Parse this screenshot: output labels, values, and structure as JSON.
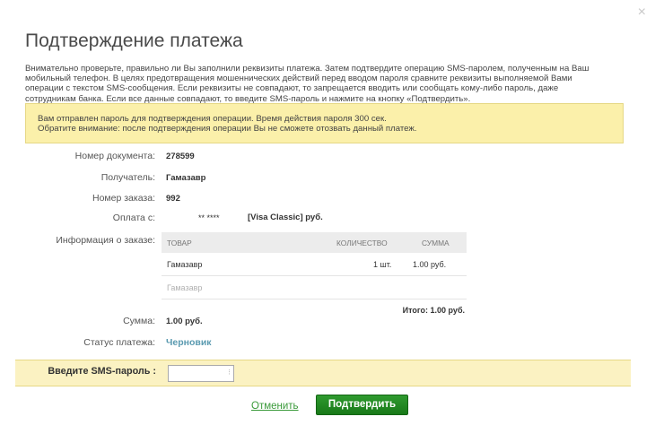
{
  "dialog": {
    "close_symbol": "×",
    "title": "Подтверждение платежа",
    "intro_lines": [
      "Внимательно проверьте, правильно ли Вы заполнили реквизиты платежа. Затем подтвердите операцию SMS-паролем, полученным на Ваш",
      "мобильный телефон. В целях предотвращения мошеннических действий перед вводом пароля сравните реквизиты выполняемой Вами",
      "операции с текстом SMS-сообщения. Если реквизиты не совпадают, то запрещается вводить или сообщать кому-либо пароль, даже",
      "сотрудникам банка. Если все данные совпадают, то введите SMS-пароль и нажмите на кнопку «Подтвердить»."
    ]
  },
  "notice": {
    "line1": "Вам отправлен пароль для подтверждения операции. Время действия пароля 300 сек.",
    "line2": "Обратите внимание: после подтверждения операции Вы не сможете отозвать данный платеж."
  },
  "fields": {
    "doc_number_label": "Номер документа:",
    "doc_number_value": "278599",
    "recipient_label": "Получатель:",
    "recipient_value": "Гамазавр",
    "order_number_label": "Номер заказа:",
    "order_number_value": "992",
    "payment_from_label": "Оплата с:",
    "card_mask": "** ****",
    "card_type": "[Visa Classic]  руб.",
    "order_info_label": "Информация о заказе:",
    "sum_label": "Сумма:",
    "sum_value": "1.00  руб.",
    "status_label": "Статус платежа:",
    "status_value": "Черновик"
  },
  "order_table": {
    "columns": [
      "ТОВАР",
      "КОЛИЧЕСТВО",
      "СУММА"
    ],
    "rows": [
      {
        "name": "Гамазавр",
        "qty": "1 шт.",
        "sum": "1.00  руб."
      },
      {
        "name": "Гамазавр",
        "qty": "",
        "sum": ""
      }
    ],
    "total": "Итого: 1.00 руб."
  },
  "sms": {
    "label": "Введите SMS-пароль :",
    "value": "",
    "icon": "key-icon"
  },
  "actions": {
    "cancel_label": "Отменить",
    "confirm_label": "Подтвердить"
  },
  "colors": {
    "notice_bg": "#fbf0aa",
    "sms_band_bg": "#fbf2c2",
    "confirm_btn": "#187918",
    "cancel_link": "#3a9a3a",
    "status_link": "#5a9ab0"
  }
}
